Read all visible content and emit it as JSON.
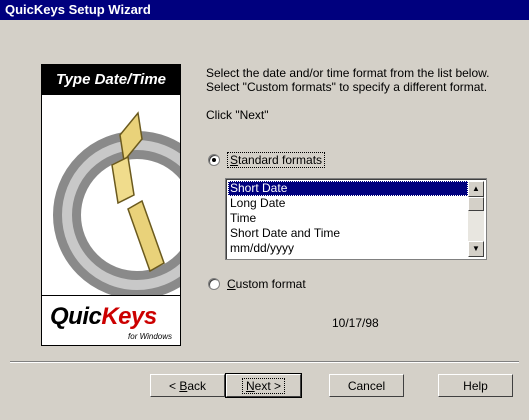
{
  "window": {
    "title": "QuicKeys Setup Wizard"
  },
  "panel": {
    "header": "Type Date/Time",
    "logo_main": "Quic",
    "logo_accent": "Keys",
    "logo_sub": "for Windows"
  },
  "instructions": {
    "line1": "Select the date and/or time format from the list below.",
    "line2": "Select \"Custom formats\" to specify a different format.",
    "click_next": "Click \"Next\""
  },
  "options": {
    "standard_prefix": "S",
    "standard_rest": "tandard formats",
    "standard_checked": true,
    "custom_prefix": "C",
    "custom_rest": "ustom format",
    "custom_checked": false
  },
  "format_list": {
    "items": [
      "Short Date",
      "Long Date",
      "Time",
      "Short Date and Time",
      "mm/dd/yyyy"
    ],
    "selected": "Short Date",
    "scroll_position": 0.0
  },
  "preview": {
    "value": "10/17/98"
  },
  "buttons": {
    "back_prefix": "< ",
    "back_ul": "B",
    "back_rest": "ack",
    "next_ul": "N",
    "next_rest": "ext >",
    "cancel": "Cancel",
    "help": "Help"
  },
  "colors": {
    "titlebar": "#00007e",
    "face": "#d4d0c8",
    "selection": "#00007e",
    "logo_accent": "#cc0000"
  }
}
